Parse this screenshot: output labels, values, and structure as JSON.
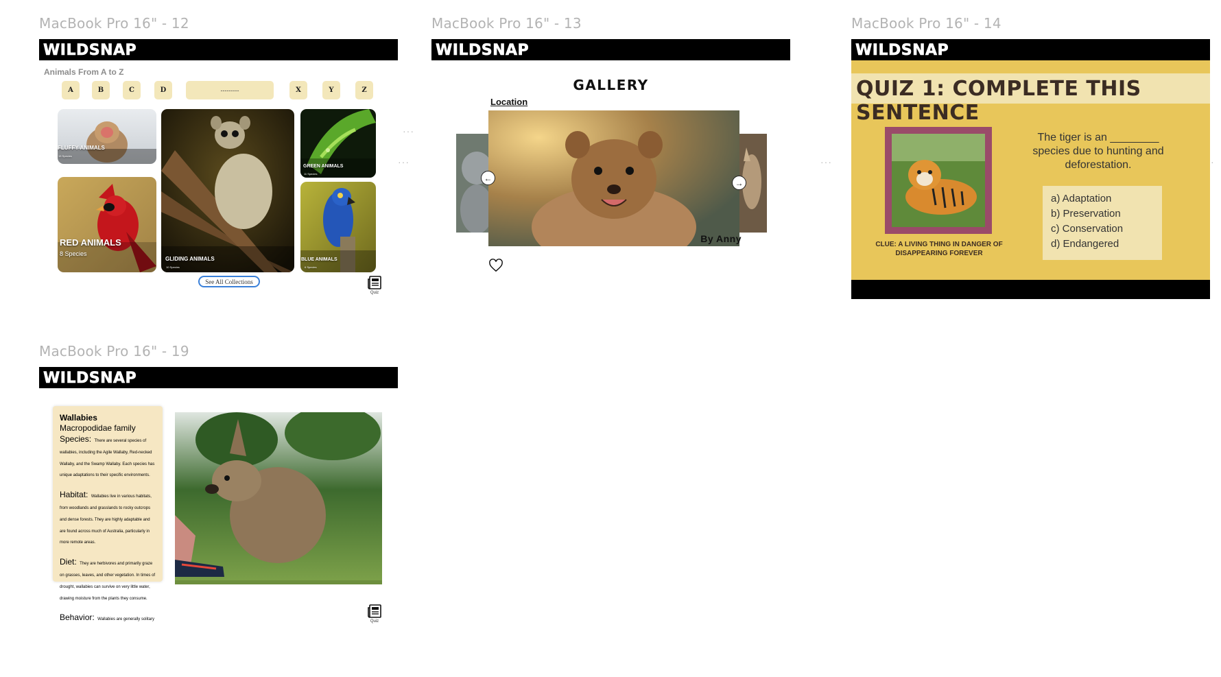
{
  "frames": {
    "f12": {
      "label": "MacBook Pro 16\" - 12",
      "logo": "WILDSNAP",
      "subtitle": "Animals From A to Z",
      "letters_left": [
        "A",
        "B",
        "C",
        "D"
      ],
      "letters_right": [
        "X",
        "Y",
        "Z"
      ],
      "search_value": "---------",
      "collections": {
        "fluffy": {
          "title": "FLUFFY ANIMALS",
          "sub": "15 Species"
        },
        "gliding": {
          "title": "GLIDING ANIMALS",
          "sub": "10 Species"
        },
        "green": {
          "title": "GREEN ANIMALS",
          "sub": "11 Species"
        },
        "red": {
          "title": "RED ANIMALS",
          "sub": "8 Species"
        },
        "blue": {
          "title": "BLUE ANIMALS",
          "sub": "6 Species"
        }
      },
      "see_all": "See All Collections",
      "quiz": "Quiz"
    },
    "f13": {
      "label": "MacBook Pro 16\" - 13",
      "logo": "WILDSNAP",
      "title": "GALLERY",
      "location": "Location",
      "author": "By Anny"
    },
    "f14": {
      "label": "MacBook Pro 16\" - 14",
      "logo": "WILDSNAP",
      "title": "QUIZ 1: COMPLETE THIS SENTENCE",
      "question": "The tiger is an ________ species due to hunting and deforestation.",
      "clue": "CLUE: A LIVING THING IN DANGER OF DISAPPEARING FOREVER",
      "options": [
        "a) Adaptation",
        "b) Preservation",
        "c) Conservation",
        "d) Endangered"
      ]
    },
    "f19": {
      "label": "MacBook Pro 16\" - 19",
      "logo": "WILDSNAP",
      "name": "Wallabies",
      "family": "Macropodidae family",
      "species_head": "Species:",
      "species_body": "There are several species of wallabies, including the Agile Wallaby, Red-necked Wallaby, and the Swamp Wallaby. Each species has unique adaptations to their specific environments.",
      "habitat_head": "Habitat:",
      "habitat_body": "Wallabies live in various habitats, from woodlands and grasslands to rocky outcrops and dense forests. They are highly adaptable and are found across much of Australia, particularly in more remote areas.",
      "diet_head": "Diet:",
      "diet_body": "They are herbivores and primarily graze on grasses, leaves, and other vegetation. In times of drought, wallabies can survive on very little water, drawing moisture from the plants they consume.",
      "behavior_head": "Behavior:",
      "behavior_body": "Wallabies are generally solitary or live in small groups. They are shy and elusive, often active during the early morning and late afternoon, avoiding the heat of the day.",
      "quiz": "Quiz"
    }
  },
  "colors": {
    "bar": "#000000",
    "letter_bg": "#f3e7ba",
    "quiz_yellow": "#e8c65a",
    "quiz_cream": "#f1e3b0",
    "stamp": "#9a4b69",
    "link_blue": "#3a80d9"
  }
}
